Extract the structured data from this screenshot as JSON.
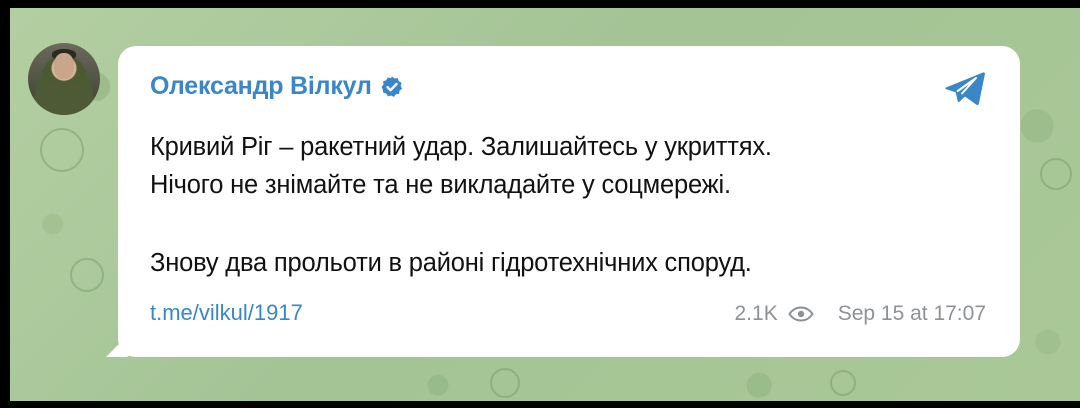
{
  "channel_post": {
    "author_name": "Олександр Вілкул",
    "verified_icon": "verified-badge-icon",
    "share_icon": "telegram-share-icon",
    "message_lines": [
      "Кривий Ріг – ракетний удар. Залишайтесь у укриттях.",
      "Нічого не знімайте та не викладайте у соцмережі.",
      "Знову два прольоти в районі гідротехнічних споруд."
    ],
    "link_text": "t.me/vilkul/1917",
    "views": "2.1K",
    "timestamp": "Sep 15 at 17:07"
  },
  "colors": {
    "accent": "#3a86c7",
    "wallpaper": "#a9c79c",
    "bubble": "#ffffff",
    "meta": "#8e9296"
  }
}
